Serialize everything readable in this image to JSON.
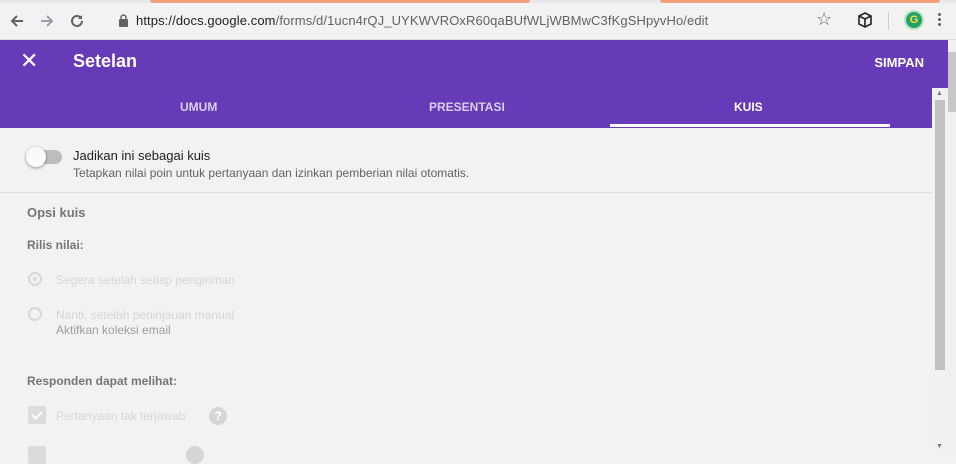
{
  "browser": {
    "url_host": "https://docs.google.com",
    "url_path": "/forms/d/1ucn4rQJ_UYKWVROxR60qaBUfWLjWBMwC3fKgSHpyvHo/edit",
    "profile_initial": "G",
    "icons": [
      "back-icon",
      "forward-icon",
      "reload-icon",
      "lock-icon",
      "star-icon",
      "extension-icon",
      "menu-icon"
    ]
  },
  "header": {
    "close_glyph": "✕",
    "title": "Setelan",
    "save_label": "SIMPAN",
    "tabs": [
      {
        "label": "UMUM"
      },
      {
        "label": "PRESENTASI"
      },
      {
        "label": "KUIS"
      }
    ],
    "active_tab": "KUIS",
    "accent": "#673ab7"
  },
  "quiz_toggle": {
    "label": "Jadikan ini sebagai kuis",
    "description": "Tetapkan nilai poin untuk pertanyaan dan izinkan pemberian nilai otomatis.",
    "enabled": false
  },
  "quiz_options": {
    "title": "Opsi kuis",
    "release_heading": "Rilis nilai:",
    "release_options": [
      {
        "label": "Segera setelah setiap pengiriman",
        "selected": true
      },
      {
        "label": "Nanti, setelah peninjauan manual",
        "sub": "Aktifkan koleksi email",
        "selected": false
      }
    ],
    "respondents_heading": "Responden dapat melihat:",
    "respondents_options": [
      {
        "label": "Pertanyaan tak terjawab",
        "checked": true,
        "help_glyph": "?"
      }
    ]
  }
}
